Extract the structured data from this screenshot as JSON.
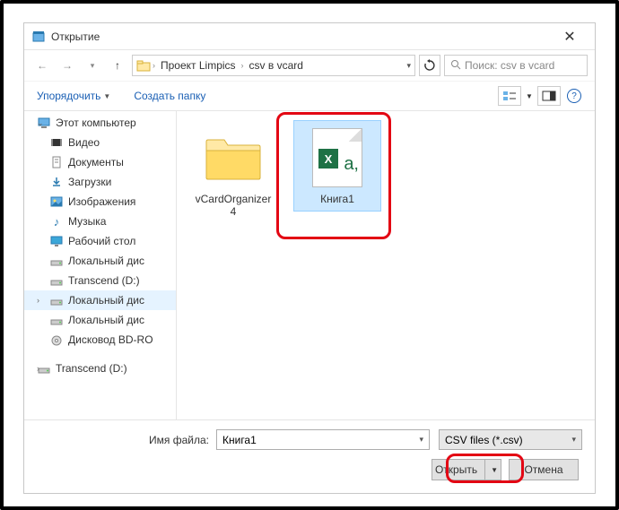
{
  "window": {
    "title": "Открытие",
    "close_glyph": "✕"
  },
  "nav": {
    "path": [
      "Проект Limpics",
      "csv в vcard"
    ],
    "search_placeholder": "Поиск: csv в vcard"
  },
  "toolbar": {
    "organize": "Упорядочить",
    "newfolder": "Создать папку"
  },
  "sidebar": {
    "items": [
      {
        "label": "Этот компьютер",
        "icon": "pc",
        "top": true
      },
      {
        "label": "Видео",
        "icon": "video"
      },
      {
        "label": "Документы",
        "icon": "doc"
      },
      {
        "label": "Загрузки",
        "icon": "down"
      },
      {
        "label": "Изображения",
        "icon": "img"
      },
      {
        "label": "Музыка",
        "icon": "music"
      },
      {
        "label": "Рабочий стол",
        "icon": "desk"
      },
      {
        "label": "Локальный дис",
        "icon": "drive"
      },
      {
        "label": "Transcend (D:)",
        "icon": "drive"
      },
      {
        "label": "Локальный дис",
        "icon": "drive",
        "hover": true
      },
      {
        "label": "Локальный дис",
        "icon": "drive"
      },
      {
        "label": "Дисковод BD-RO",
        "icon": "disc"
      },
      {
        "label": "Transcend (D:)",
        "icon": "drive",
        "top2": true
      }
    ]
  },
  "files": [
    {
      "name": "vCardOrganizer4",
      "type": "folder",
      "selected": false
    },
    {
      "name": "Книга1",
      "type": "csv",
      "selected": true
    }
  ],
  "footer": {
    "filename_label": "Имя файла:",
    "filename_value": "Книга1",
    "filter_value": "CSV files (*.csv)",
    "open": "Открыть",
    "cancel": "Отмена"
  }
}
